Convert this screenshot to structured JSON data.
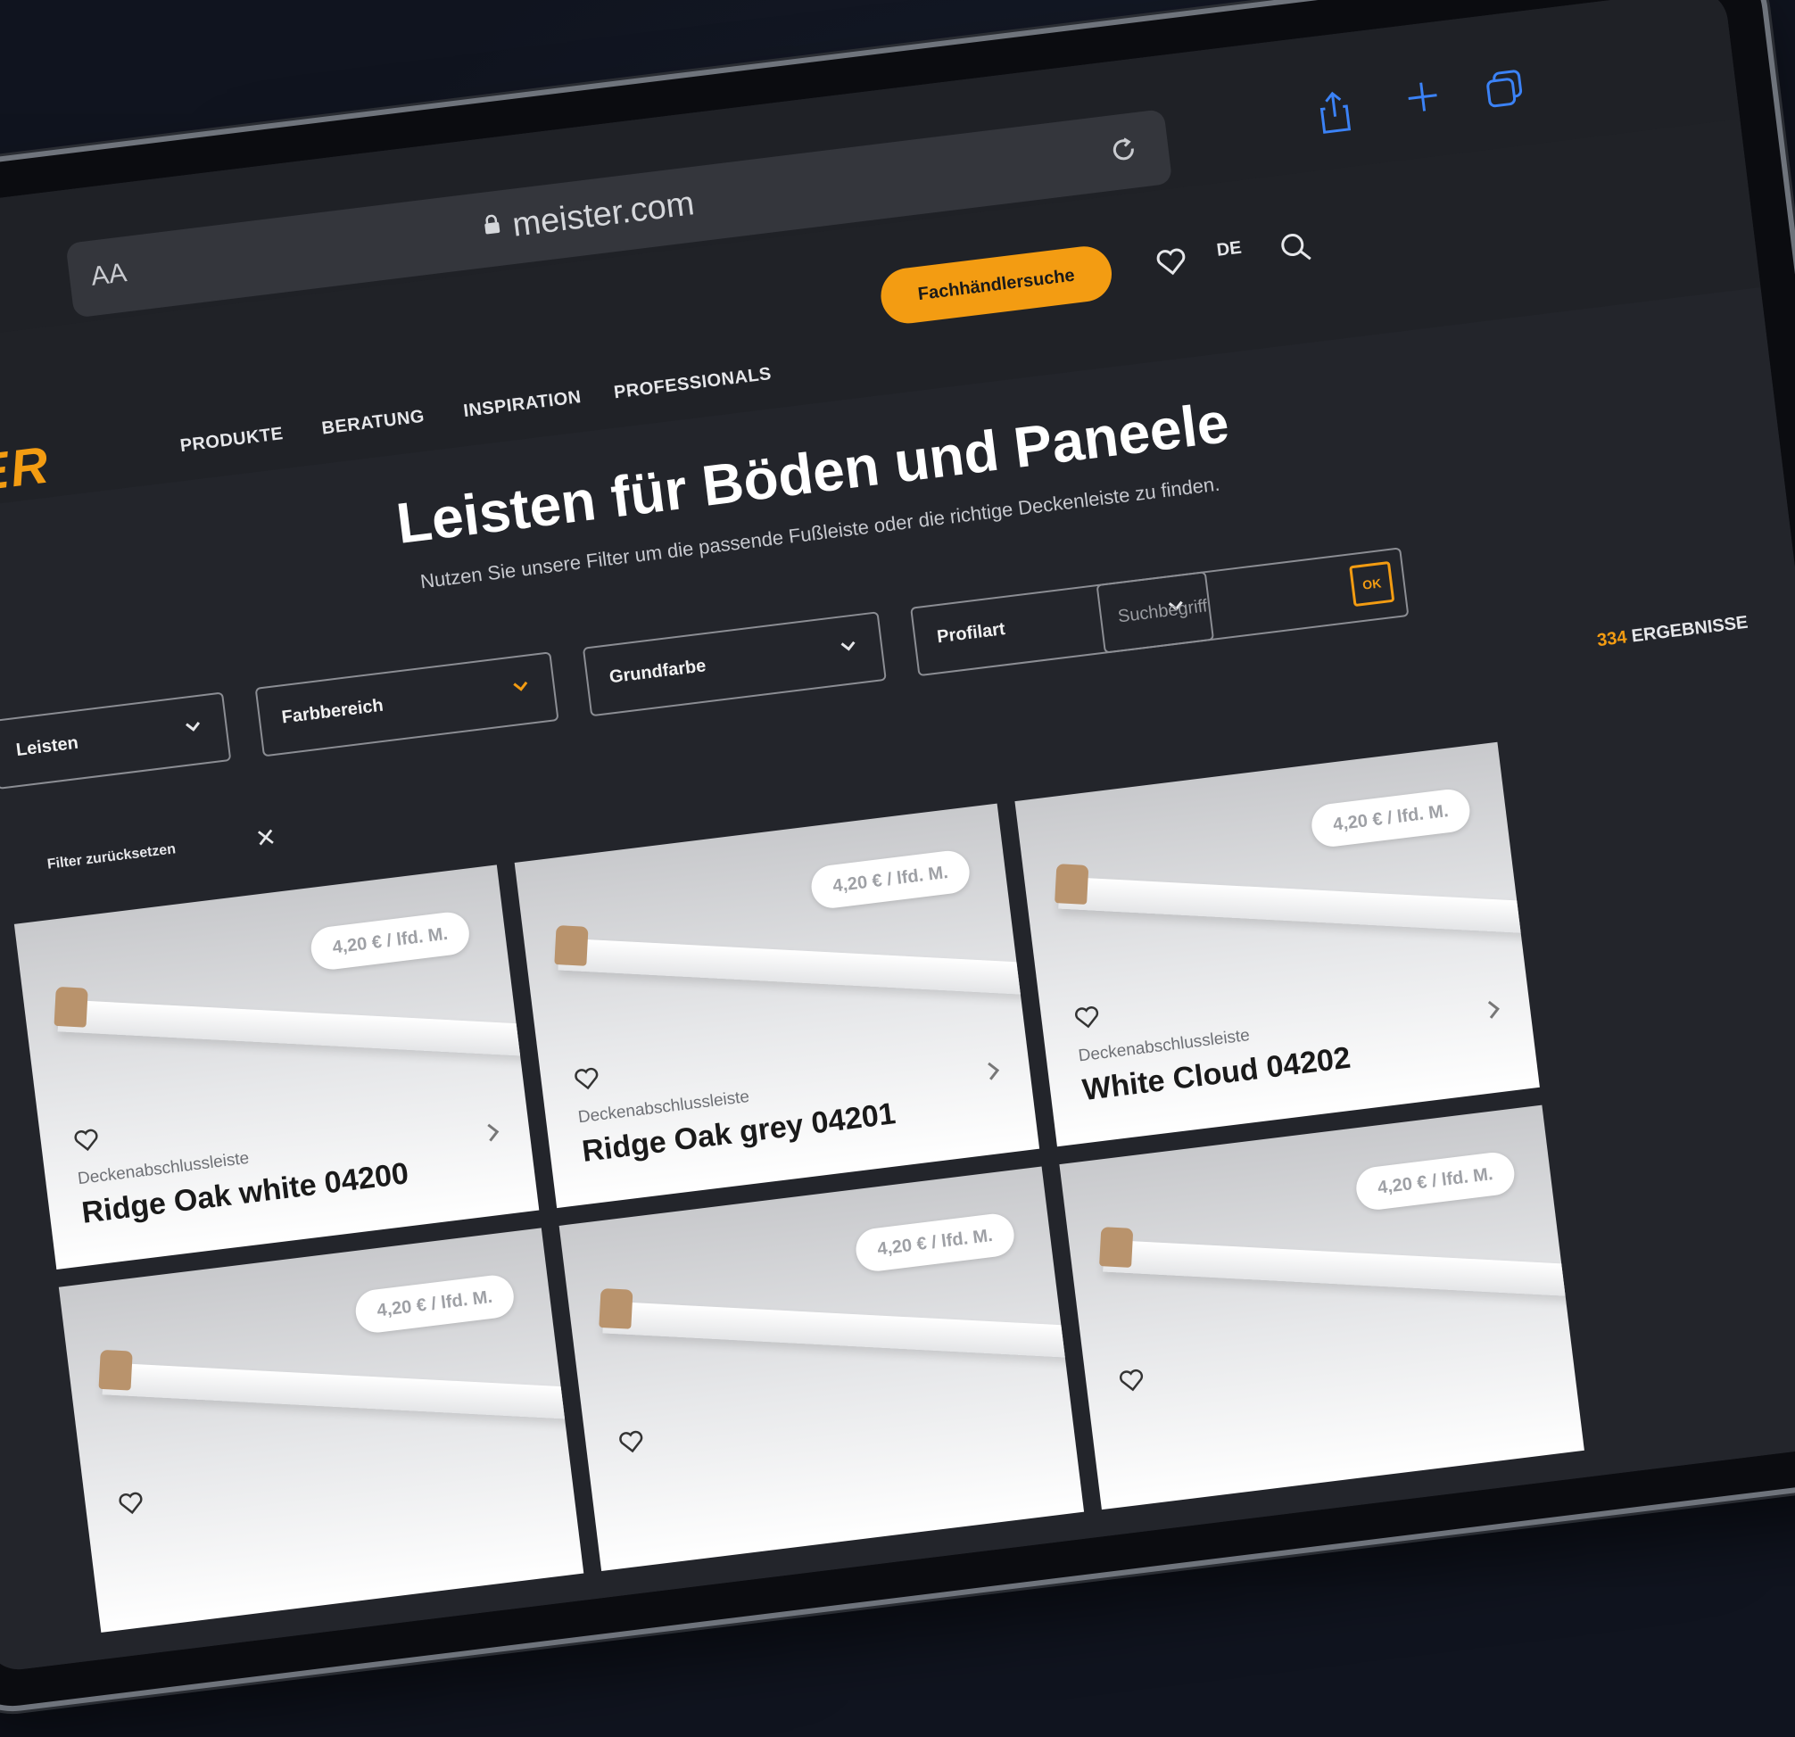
{
  "browser": {
    "aa_label": "AA",
    "url": "meister.com",
    "icons": [
      "lock-icon",
      "reload-icon",
      "share-icon",
      "new-tab-icon",
      "tabs-icon"
    ]
  },
  "header": {
    "logo": "TER",
    "nav": [
      "PRODUKTE",
      "BERATUNG",
      "INSPIRATION",
      "PROFESSIONALS"
    ],
    "dealer_button": "Fachhändlersuche",
    "language": "DE",
    "icons": [
      "heart-icon",
      "search-icon"
    ]
  },
  "page": {
    "title": "Leisten für Böden und Paneele",
    "subtitle": "Nutzen Sie unsere Filter um die passende Fußleiste oder die richtige Deckenleiste zu finden."
  },
  "filters": [
    {
      "label": "Leisten"
    },
    {
      "label": "Farbbereich"
    },
    {
      "label": "Grundfarbe"
    },
    {
      "label": "Profilart"
    }
  ],
  "search": {
    "placeholder": "Suchbegriff",
    "ok_label": "OK"
  },
  "results": {
    "count": "334",
    "label": "ERGEBNISSE"
  },
  "reset_label": "Filter zurücksetzen",
  "products": [
    {
      "price": "4,20 € / lfd. M.",
      "type": "Deckenabschlussleiste",
      "name": "Ridge Oak white 04200"
    },
    {
      "price": "4,20 € / lfd. M.",
      "type": "Deckenabschlussleiste",
      "name": "Ridge Oak grey 04201"
    },
    {
      "price": "4,20 € / lfd. M.",
      "type": "Deckenabschlussleiste",
      "name": "White Cloud 04202"
    },
    {
      "price": "4,20 € / lfd. M.",
      "type": "",
      "name": ""
    },
    {
      "price": "4,20 € / lfd. M.",
      "type": "",
      "name": ""
    },
    {
      "price": "4,20 € / lfd. M.",
      "type": "",
      "name": ""
    }
  ],
  "colors": {
    "accent": "#f39c12",
    "background": "#23252b",
    "frame": "#10141f"
  }
}
